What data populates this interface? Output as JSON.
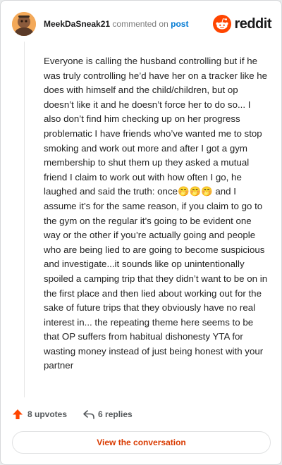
{
  "comment": {
    "username": "MeekDaSneak21",
    "action_text": "commented on",
    "post_link_text": "post",
    "body": "Everyone is calling the husband controlling but if he was truly controlling he’d have her on a tracker like he does with himself and the child/children, but op doesn’t like it and he doesn’t force her to do so... I also don’t find him checking up on her progress problematic I have friends who’ve wanted me to stop smoking and work out more and after I got a gym membership to shut them up they asked a mutual friend I claim to work out with how often I go, he laughed and said the truth: once🤭🤭🤭 and I assume it’s for the same reason, if you claim to go to the gym on the regular it’s going to be evident one way or the other if you’re actually going and people who are being lied to are going to become suspicious and investigate...it sounds like op unintentionally spoiled a camping trip that they didn’t want to be on in the first place and then lied about working out for the sake of future trips that they obviously have no real interest in... the repeating theme here seems to be that OP suffers from habitual dishonesty YTA for wasting money instead of just being honest with your partner"
  },
  "brand": {
    "logo_text": "reddit",
    "logo_color": "#ff4500"
  },
  "footer": {
    "upvotes": "8 upvotes",
    "replies": "6 replies",
    "upvote_color": "#ff4500"
  },
  "cta": {
    "label": "View the conversation",
    "color": "#d93a00"
  },
  "icons": {
    "avatar": "avatar",
    "logo": "reddit-snoo-icon",
    "upvote": "upvote-arrow-icon",
    "reply": "reply-arrow-icon"
  }
}
